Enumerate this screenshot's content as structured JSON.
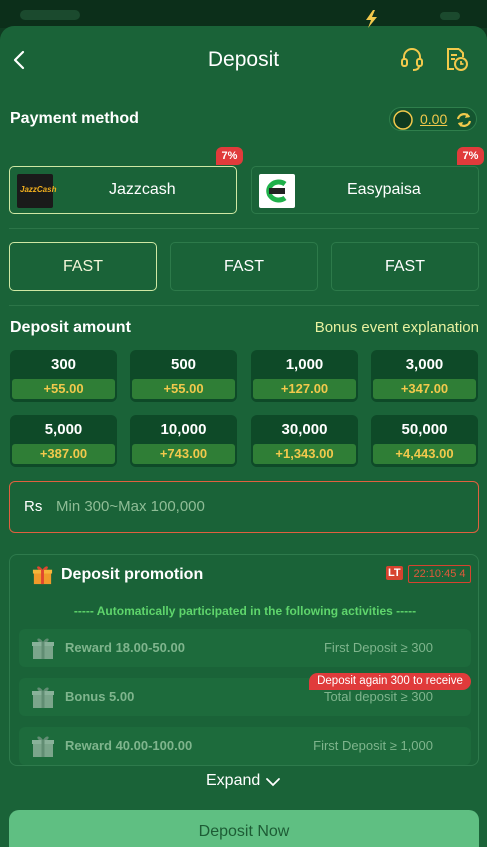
{
  "header": {
    "title": "Deposit",
    "back_icon": "chevron-left-icon",
    "support_icon": "headset-icon",
    "history_icon": "history-icon"
  },
  "payment": {
    "label": "Payment method",
    "balance": "0.00",
    "methods": [
      {
        "name": "Jazzcash",
        "badge": "7%",
        "logo_text": "JazzCash",
        "active": true
      },
      {
        "name": "Easypaisa",
        "badge": "7%",
        "active": false
      }
    ],
    "channels": [
      {
        "label": "FAST",
        "active": true
      },
      {
        "label": "FAST",
        "active": false
      },
      {
        "label": "FAST",
        "active": false
      }
    ]
  },
  "amount": {
    "label": "Deposit amount",
    "bonus_link": "Bonus event explanation",
    "options": [
      {
        "value": "300",
        "bonus": "+55.00"
      },
      {
        "value": "500",
        "bonus": "+55.00"
      },
      {
        "value": "1,000",
        "bonus": "+127.00"
      },
      {
        "value": "3,000",
        "bonus": "+347.00"
      },
      {
        "value": "5,000",
        "bonus": "+387.00"
      },
      {
        "value": "10,000",
        "bonus": "+743.00"
      },
      {
        "value": "30,000",
        "bonus": "+1,343.00"
      },
      {
        "value": "50,000",
        "bonus": "+4,443.00"
      }
    ],
    "currency": "Rs",
    "placeholder": "Min 300~Max 100,000"
  },
  "promotion": {
    "title": "Deposit promotion",
    "lt_label": "LT",
    "timer": "22:10:45 4",
    "subtitle": "----- Automatically participated in the following activities -----",
    "rows": [
      {
        "left": "Reward 18.00-50.00",
        "right": "First Deposit ≥ 300"
      },
      {
        "left": "Bonus 5.00",
        "right": "Total deposit ≥ 300"
      },
      {
        "left": "Reward 40.00-100.00",
        "right": "First Deposit ≥ 1,000"
      }
    ],
    "again_badge": "Deposit again 300 to receive",
    "expand": "Expand"
  },
  "actions": {
    "deposit_now": "Deposit Now"
  },
  "colors": {
    "background": "#1a6338",
    "accent_gold": "#f2c94c",
    "badge_red": "#e03b3b",
    "button": "#5fbf82"
  }
}
